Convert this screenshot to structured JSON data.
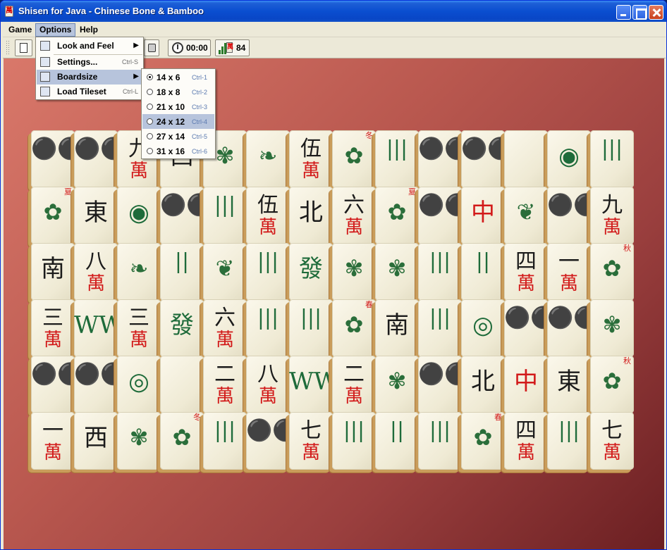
{
  "window": {
    "title": "Shisen for Java - Chinese Bone & Bamboo"
  },
  "menubar": {
    "game": "Game",
    "options": "Options",
    "help": "Help"
  },
  "toolbar": {
    "timer": "00:00",
    "tiles_left": "84"
  },
  "options_menu": {
    "items": [
      {
        "label": "Look and Feel",
        "accel": "",
        "submenu": true
      },
      {
        "label": "Settings...",
        "accel": "Ctrl-S",
        "submenu": false
      },
      {
        "label": "Boardsize",
        "accel": "",
        "submenu": true
      },
      {
        "label": "Load Tileset",
        "accel": "Ctrl-L",
        "submenu": false
      }
    ]
  },
  "boardsize_menu": {
    "items": [
      {
        "label": "14 x 6",
        "accel": "Ctrl-1",
        "selected": true
      },
      {
        "label": "18 x 8",
        "accel": "Ctrl-2",
        "selected": false
      },
      {
        "label": "21 x 10",
        "accel": "Ctrl-3",
        "selected": false
      },
      {
        "label": "24 x 12",
        "accel": "Ctrl-4",
        "selected": false
      },
      {
        "label": "27 x 14",
        "accel": "Ctrl-5",
        "selected": false
      },
      {
        "label": "31 x 16",
        "accel": "Ctrl-6",
        "selected": false
      }
    ]
  },
  "board": {
    "tiles": [
      [
        {
          "g": "⚫⚫⚫",
          "s": "",
          "c": "green"
        },
        {
          "g": "⚫⚫⚫",
          "s": "",
          "c": "green"
        },
        {
          "g": "九",
          "s": "萬"
        },
        {
          "g": "西",
          "s": "",
          "c": "big"
        },
        {
          "g": "✾",
          "s": "",
          "c": "sym"
        },
        {
          "g": "❧",
          "s": "",
          "c": "sym"
        },
        {
          "g": "伍",
          "s": "萬"
        },
        {
          "g": "✿",
          "s": "",
          "c": "sym",
          "tag": "冬"
        },
        {
          "g": "|||",
          "s": "",
          "c": "green"
        },
        {
          "g": "⚫⚫⚫",
          "s": "",
          "c": "green"
        },
        {
          "g": "⚫⚫⚫",
          "s": "",
          "c": "green"
        },
        {
          "g": "",
          "s": ""
        },
        {
          "g": "◉",
          "s": "",
          "c": "green big"
        },
        {
          "g": "|||",
          "s": "",
          "c": "green"
        }
      ],
      [
        {
          "g": "✿",
          "s": "",
          "c": "sym",
          "tag": "夏"
        },
        {
          "g": "東",
          "s": "",
          "c": "big"
        },
        {
          "g": "◉",
          "s": "",
          "c": "green big"
        },
        {
          "g": "⚫⚫",
          "s": "",
          "c": "green"
        },
        {
          "g": "|||",
          "s": "",
          "c": "green"
        },
        {
          "g": "伍",
          "s": "萬"
        },
        {
          "g": "北",
          "s": "",
          "c": "big"
        },
        {
          "g": "六",
          "s": "萬"
        },
        {
          "g": "✿",
          "s": "",
          "c": "sym",
          "tag": "夏"
        },
        {
          "g": "⚫⚫",
          "s": "",
          "c": "green"
        },
        {
          "g": "中",
          "s": "",
          "c": "red big"
        },
        {
          "g": "❦",
          "s": "",
          "c": "sym"
        },
        {
          "g": "⚫⚫⚫",
          "s": "",
          "c": "green"
        },
        {
          "g": "九",
          "s": "萬"
        }
      ],
      [
        {
          "g": "南",
          "s": "",
          "c": "big"
        },
        {
          "g": "八",
          "s": "萬"
        },
        {
          "g": "❧",
          "s": "",
          "c": "sym"
        },
        {
          "g": "||",
          "s": "",
          "c": "green"
        },
        {
          "g": "❦",
          "s": "",
          "c": "sym"
        },
        {
          "g": "|||",
          "s": "",
          "c": "green"
        },
        {
          "g": "發",
          "s": "",
          "c": "green big"
        },
        {
          "g": "✾",
          "s": "",
          "c": "sym"
        },
        {
          "g": "✾",
          "s": "",
          "c": "sym"
        },
        {
          "g": "|||",
          "s": "",
          "c": "green"
        },
        {
          "g": "||",
          "s": "",
          "c": "green"
        },
        {
          "g": "四",
          "s": "萬"
        },
        {
          "g": "一",
          "s": "萬"
        },
        {
          "g": "✿",
          "s": "",
          "c": "sym",
          "tag": "秋"
        }
      ],
      [
        {
          "g": "三",
          "s": "萬"
        },
        {
          "g": "WW",
          "s": "",
          "c": "green big"
        },
        {
          "g": "三",
          "s": "萬"
        },
        {
          "g": "發",
          "s": "",
          "c": "green big"
        },
        {
          "g": "六",
          "s": "萬"
        },
        {
          "g": "|||",
          "s": "",
          "c": "green"
        },
        {
          "g": "|||",
          "s": "",
          "c": "green"
        },
        {
          "g": "✿",
          "s": "",
          "c": "sym",
          "tag": "春"
        },
        {
          "g": "南",
          "s": "",
          "c": "big"
        },
        {
          "g": "|||",
          "s": "",
          "c": "green"
        },
        {
          "g": "◎",
          "s": "",
          "c": "green big"
        },
        {
          "g": "⚫⚫⚫",
          "s": "",
          "c": "green"
        },
        {
          "g": "⚫⚫",
          "s": "",
          "c": "green"
        },
        {
          "g": "✾",
          "s": "",
          "c": "sym"
        }
      ],
      [
        {
          "g": "⚫⚫⚫",
          "s": "",
          "c": "green"
        },
        {
          "g": "⚫⚫⚫",
          "s": "",
          "c": "green"
        },
        {
          "g": "◎",
          "s": "",
          "c": "green big"
        },
        {
          "g": "",
          "s": ""
        },
        {
          "g": "二",
          "s": "萬"
        },
        {
          "g": "八",
          "s": "萬"
        },
        {
          "g": "WW",
          "s": "",
          "c": "green big"
        },
        {
          "g": "二",
          "s": "萬"
        },
        {
          "g": "✾",
          "s": "",
          "c": "sym"
        },
        {
          "g": "⚫⚫",
          "s": "",
          "c": "green"
        },
        {
          "g": "北",
          "s": "",
          "c": "big"
        },
        {
          "g": "中",
          "s": "",
          "c": "red big"
        },
        {
          "g": "東",
          "s": "",
          "c": "big"
        },
        {
          "g": "✿",
          "s": "",
          "c": "sym",
          "tag": "秋"
        }
      ],
      [
        {
          "g": "一",
          "s": "萬"
        },
        {
          "g": "西",
          "s": "",
          "c": "big"
        },
        {
          "g": "✾",
          "s": "",
          "c": "sym"
        },
        {
          "g": "✿",
          "s": "",
          "c": "sym",
          "tag": "冬"
        },
        {
          "g": "|||",
          "s": "",
          "c": "green"
        },
        {
          "g": "⚫⚫⚫",
          "s": "",
          "c": "green"
        },
        {
          "g": "七",
          "s": "萬"
        },
        {
          "g": "|||",
          "s": "",
          "c": "green"
        },
        {
          "g": "||",
          "s": "",
          "c": "green"
        },
        {
          "g": "|||",
          "s": "",
          "c": "green"
        },
        {
          "g": "✿",
          "s": "",
          "c": "sym",
          "tag": "春"
        },
        {
          "g": "四",
          "s": "萬"
        },
        {
          "g": "|||",
          "s": "",
          "c": "green"
        },
        {
          "g": "七",
          "s": "萬"
        }
      ]
    ]
  }
}
